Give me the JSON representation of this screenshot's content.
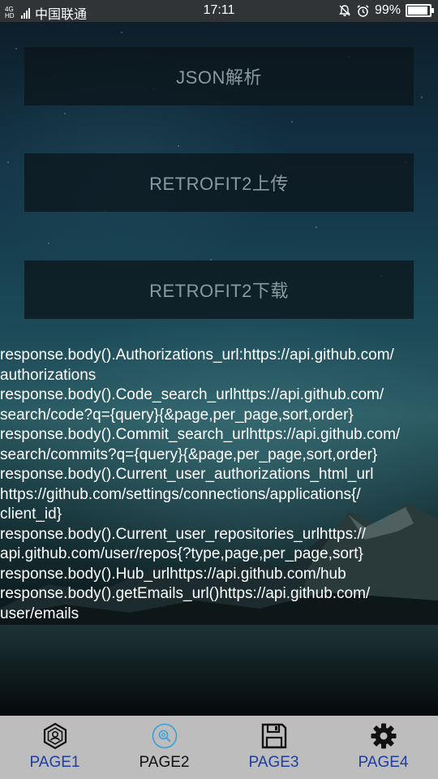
{
  "status_bar": {
    "network_top": "4G",
    "network_bottom": "HD",
    "carrier": "中国联通",
    "time": "17:11",
    "battery_percent": "99%",
    "battery_level": 0.99,
    "icons": [
      "signal-icon",
      "bell-off-icon",
      "alarm-icon",
      "battery-icon"
    ]
  },
  "buttons": {
    "json_label": "JSON解析",
    "upload_label": "RETROFIT2上传",
    "download_label": "RETROFIT2下载"
  },
  "response_lines": [
    "response.body().Authorizations_url:https://api.github.com/",
    "authorizations",
    "response.body().Code_search_urlhttps://api.github.com/",
    "search/code?q={query}{&page,per_page,sort,order}",
    "response.body().Commit_search_urlhttps://api.github.com/",
    "search/commits?q={query}{&page,per_page,sort,order}",
    "response.body().Current_user_authorizations_html_url",
    "https://github.com/settings/connections/applications{/",
    "client_id}",
    "response.body().Current_user_repositories_urlhttps://",
    "api.github.com/user/repos{?type,page,per_page,sort}",
    "response.body().Hub_urlhttps://api.github.com/hub",
    "response.body().getEmails_url()https://api.github.com/",
    "user/emails"
  ],
  "tabs": [
    {
      "label": "PAGE1",
      "icon": "hexagon-badge-icon",
      "color": "#1f3d9c"
    },
    {
      "label": "PAGE2",
      "icon": "search-circle-icon",
      "color": "#111111",
      "selected": true
    },
    {
      "label": "PAGE3",
      "icon": "save-icon",
      "color": "#1f3d9c"
    },
    {
      "label": "PAGE4",
      "icon": "gear-icon",
      "color": "#1f3d9c"
    }
  ],
  "colors": {
    "tab_bar_bg": "#bdbdbd",
    "tab_label_blue": "#1f3d9c",
    "accent_selected_icon": "#3aa0d8"
  }
}
